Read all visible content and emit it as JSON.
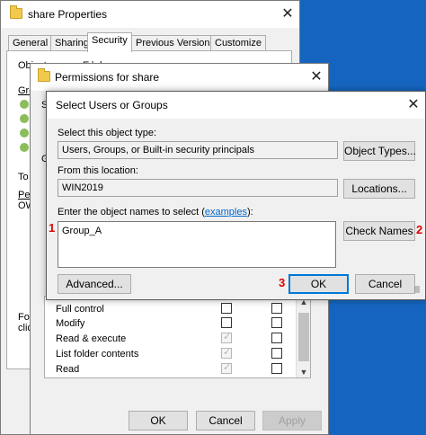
{
  "share_props": {
    "title": "share Properties",
    "tabs": [
      "General",
      "Sharing",
      "Security",
      "Previous Versions",
      "Customize"
    ],
    "active_tab": "Security",
    "frag_object": "Object name:",
    "frag_object_val": "E:\\share",
    "frag_g": "Gro",
    "frag_to": "To",
    "frag_pe": "Pe",
    "frag_ow": "OW",
    "frag_fo": "For",
    "frag_cli": "clic",
    "buttons": {
      "ok": "OK",
      "cancel": "Cancel",
      "apply": "Apply"
    }
  },
  "perm_dialog": {
    "title": "Permissions for share",
    "frag_s": "Se",
    "permissions": [
      "Full control",
      "Modify",
      "Read & execute",
      "List folder contents",
      "Read"
    ]
  },
  "select_dialog": {
    "title": "Select Users or Groups",
    "object_type_label": "Select this object type:",
    "object_type_value": "Users, Groups, or Built-in security principals",
    "object_types_button": "Object Types...",
    "location_label": "From this location:",
    "location_value": "WIN2019",
    "locations_button": "Locations...",
    "names_label_prefix": "Enter the object names to select (",
    "names_label_link": "examples",
    "names_label_suffix": "):",
    "names_value": "Group_A",
    "check_names_button": "Check Names",
    "advanced_button": "Advanced...",
    "ok_button": "OK",
    "cancel_button": "Cancel"
  },
  "annotations": {
    "one": "1",
    "two": "2",
    "three": "3"
  },
  "icons": {
    "close": "close-icon",
    "folder": "folder-icon",
    "checkbox": "checkbox"
  },
  "colors": {
    "desktop": "#1565c0",
    "annotation": "#e00000",
    "focus": "#0078d7"
  }
}
